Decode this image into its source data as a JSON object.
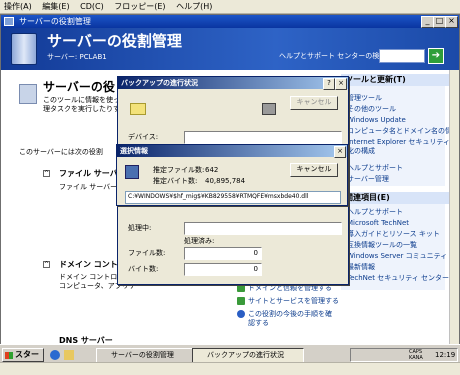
{
  "vm_menu": [
    "操作(A)",
    "編集(E)",
    "CD(C)",
    "フロッピー(E)",
    "ヘルプ(H)"
  ],
  "main_window": {
    "title": "サーバーの役割管理",
    "banner_title": "サーバーの役割管理",
    "server_label": "サーバー: PCLAB1",
    "help_search_label": "ヘルプとサポート センターの検索(S)",
    "go_icon": "arrow-right-icon"
  },
  "content": {
    "heading": "サーバーの役",
    "intro_line1": "このツールに情報を使って",
    "intro_line2": "理タスクを実行したりするこ",
    "server_roles_line": "このサーバーには次の役割",
    "file_server_heading": "ファイル サーバー",
    "file_server_desc": "ファイル サーバーは",
    "dc_heading": "ドメイン コントローラ",
    "dc_desc1": "ドメイン コントロー",
    "dc_desc2": "コンピュータ、アプリケー",
    "dns_heading": "DNS サーバー",
    "actions": [
      "ドメインと信頼を管理する",
      "サイトとサービスを管理する",
      "この役割の今後の手順を確",
      "認する"
    ]
  },
  "right_panel": {
    "tools_header": "ツールと更新(T)",
    "tools_items": [
      "管理ツール",
      "その他のツール",
      "Windows Update",
      "コンピュータ名とドメイン名の情報",
      "Internet Explorer セキュリティ強",
      "化の構成"
    ],
    "support_link": "ヘルプとサポート",
    "support_link2": "サーバー管理",
    "related_header": "関連項目(E)",
    "related_items": [
      "ヘルプとサポート",
      "Microsoft TechNet",
      "導入ガイドとリソース キット",
      "互換情報ツールの一覧",
      "Windows Server コミュニティ",
      "最新情報",
      "TechNet セキュリティ センター"
    ]
  },
  "backup_dialog": {
    "title": "バックアップの進行状況",
    "help_btn": "?",
    "close_btn": "×",
    "cancel_label": "キャンセル",
    "device_label": "デバイス:",
    "processing_label": "処理中:",
    "processed_label": "処理済み:",
    "file_count_label": "ファイル数:",
    "file_count_value": "0",
    "byte_count_label": "バイト数:",
    "byte_count_value": "0"
  },
  "selection_dialog": {
    "title": "選択情報",
    "close_btn": "×",
    "est_files_label": "推定ファイル数:",
    "est_files_value": "642",
    "est_bytes_label": "推定バイト数:",
    "est_bytes_value": "40,895,784",
    "cancel_label": "キャンセル",
    "path": "C:¥WINDOWS¥$hf_mig$¥KB829558¥RTMQFE¥msxbde40.dll"
  },
  "taskbar": {
    "start_label": "スタート",
    "tasks": [
      "サーバーの役割管理",
      "バックアップの進行状況"
    ],
    "ime_top": "CAPS",
    "ime_bottom": "KANA",
    "clock": "12:19"
  }
}
